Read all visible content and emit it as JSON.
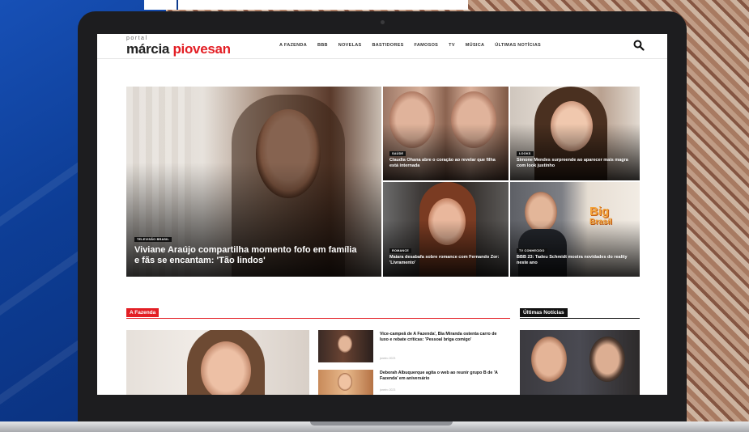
{
  "site": {
    "logo_small": "portal",
    "logo_word1": "márcia",
    "logo_word2": "piovesan",
    "nav": [
      "A FAZENDA",
      "BBB",
      "NOVELAS",
      "BASTIDORES",
      "FAMOSOS",
      "TV",
      "MÚSICA",
      "ÚLTIMAS NOTÍCIAS"
    ]
  },
  "hero": {
    "main": {
      "tag": "TELEVISÃO BRASIL",
      "title": "Viviane Araújo compartilha momento fofo em família e fãs se encantam: 'Tão lindos'"
    },
    "items": [
      {
        "tag": "SAÚDE",
        "title": "Claudia Ohana abre o coração ao revelar que filha está internada"
      },
      {
        "tag": "LOOKS",
        "title": "Simone Mendes surpreende ao aparecer mais magra com look justinho"
      },
      {
        "tag": "ROMANCE",
        "title": "Maiara desabafa sobre romance com Fernando Zor: 'Livramento'"
      },
      {
        "tag": "TV CONHECIDO",
        "title": "BBB 23: Tadeu Schmidt mostra novidades do reality neste ano"
      }
    ]
  },
  "bbb_logo": [
    "Big",
    "Brasil"
  ],
  "sections": {
    "fazenda": {
      "label": "A Fazenda",
      "items": [
        {
          "title": "Vice-campeã de A Fazenda', Bia Miranda ostenta carro de luxo e rebate críticas: 'Pessoal briga comigo'",
          "meta": "janeiro 2023"
        },
        {
          "title": "Deborah Albuquerque agita o web ao reunir grupo B de 'A Fazenda' em aniversário",
          "meta": "janeiro 2023"
        }
      ]
    },
    "ultimas": {
      "label": "Últimas Notícias"
    }
  },
  "colors": {
    "brand_red": "#e31e24",
    "dark": "#111111",
    "backdrop_blue": "#0c3a8e"
  }
}
